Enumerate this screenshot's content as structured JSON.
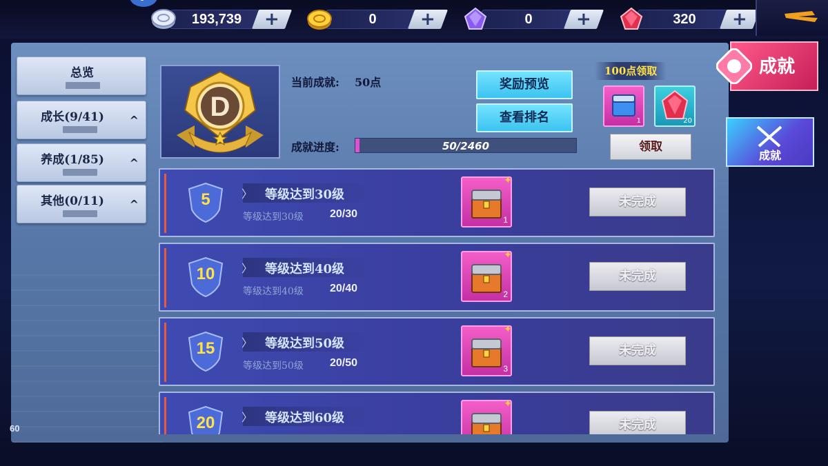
{
  "currencies": [
    {
      "name": "silver-coin",
      "value": "193,739",
      "icon": "silver-coin-icon"
    },
    {
      "name": "gold-coin",
      "value": "0",
      "icon": "gold-coin-icon"
    },
    {
      "name": "purple-gem",
      "value": "0",
      "icon": "purple-gem-icon"
    },
    {
      "name": "red-gem",
      "value": "320",
      "icon": "red-gem-icon"
    }
  ],
  "plus_label": "+",
  "nav": [
    {
      "label": "总览",
      "sub": "",
      "chevron": ""
    },
    {
      "label": "成长(9/41)",
      "sub": "",
      "chevron": "^"
    },
    {
      "label": "养成(1/85)",
      "sub": "",
      "chevron": "^"
    },
    {
      "label": "其他(0/11)",
      "sub": "",
      "chevron": "^"
    }
  ],
  "header": {
    "badge_letter": "D",
    "current_label": "当前成就:",
    "current_value": "50点",
    "progress_label": "成就进度:",
    "progress_text": "50/2460",
    "progress_fraction": 0.0203,
    "preview_button": "奖励预览",
    "ranking_button": "查看排名",
    "milestone_title": "100点领取",
    "milestone_rewards": [
      {
        "icon": "blue-chest-icon",
        "qty": "1"
      },
      {
        "icon": "red-gem-icon",
        "qty": "20"
      }
    ],
    "claim_button": "领取"
  },
  "achievements": [
    {
      "level": "5",
      "title": "等级达到30级",
      "desc": "等级达到30级",
      "progress": "20/30",
      "reward_qty": "1",
      "status": "未完成"
    },
    {
      "level": "10",
      "title": "等级达到40级",
      "desc": "等级达到40级",
      "progress": "20/40",
      "reward_qty": "2",
      "status": "未完成"
    },
    {
      "level": "15",
      "title": "等级达到50级",
      "desc": "等级达到50级",
      "progress": "20/50",
      "reward_qty": "3",
      "status": "未完成"
    },
    {
      "level": "20",
      "title": "等级达到60级",
      "desc": "",
      "progress": "",
      "reward_qty": "",
      "status": "未完成"
    }
  ],
  "right_tabs": [
    {
      "label": "成就",
      "icon": "achievement-emblem-icon"
    },
    {
      "label": "成就",
      "icon": "crossed-swords-icon"
    }
  ],
  "fps": "60",
  "colors": {
    "accent_gold": "#ffe24a",
    "panel_blue": "#5677a8",
    "row_blue": "#3a3e9e",
    "reward_pink": "#f35ec8",
    "tab_red": "#e23a70",
    "tab_purple": "#5a48d8"
  }
}
